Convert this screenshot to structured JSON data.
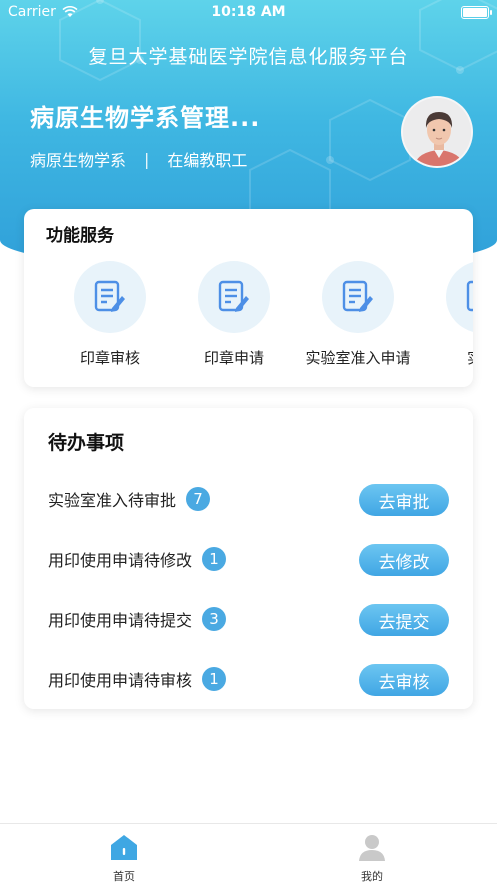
{
  "status_bar": {
    "carrier": "Carrier",
    "time": "10:18 AM"
  },
  "header": {
    "platform_title": "复旦大学基础医学院信息化服务平台",
    "user_name": "病原生物学系管理...",
    "department": "病原生物学系",
    "divider": "|",
    "staff_type": "在编教职工"
  },
  "services": {
    "title": "功能服务",
    "items": [
      {
        "label": "印章审核",
        "icon": "document-edit-icon"
      },
      {
        "label": "印章申请",
        "icon": "document-edit-icon"
      },
      {
        "label": "实验室准入申请",
        "icon": "document-edit-icon"
      },
      {
        "label": "实验",
        "icon": "document-edit-icon"
      }
    ]
  },
  "todos": {
    "title": "待办事项",
    "items": [
      {
        "label": "实验室准入待审批",
        "count": "7",
        "action": "去审批"
      },
      {
        "label": "用印使用申请待修改",
        "count": "1",
        "action": "去修改"
      },
      {
        "label": "用印使用申请待提交",
        "count": "3",
        "action": "去提交"
      },
      {
        "label": "用印使用申请待审核",
        "count": "1",
        "action": "去审核"
      }
    ]
  },
  "tabbar": {
    "home_label": "首页",
    "me_label": "我的",
    "active_color": "#3fa7e3"
  },
  "colors": {
    "accent": "#40a6e4",
    "header_top": "#5ed3ea",
    "header_bottom": "#2f9fd9"
  }
}
